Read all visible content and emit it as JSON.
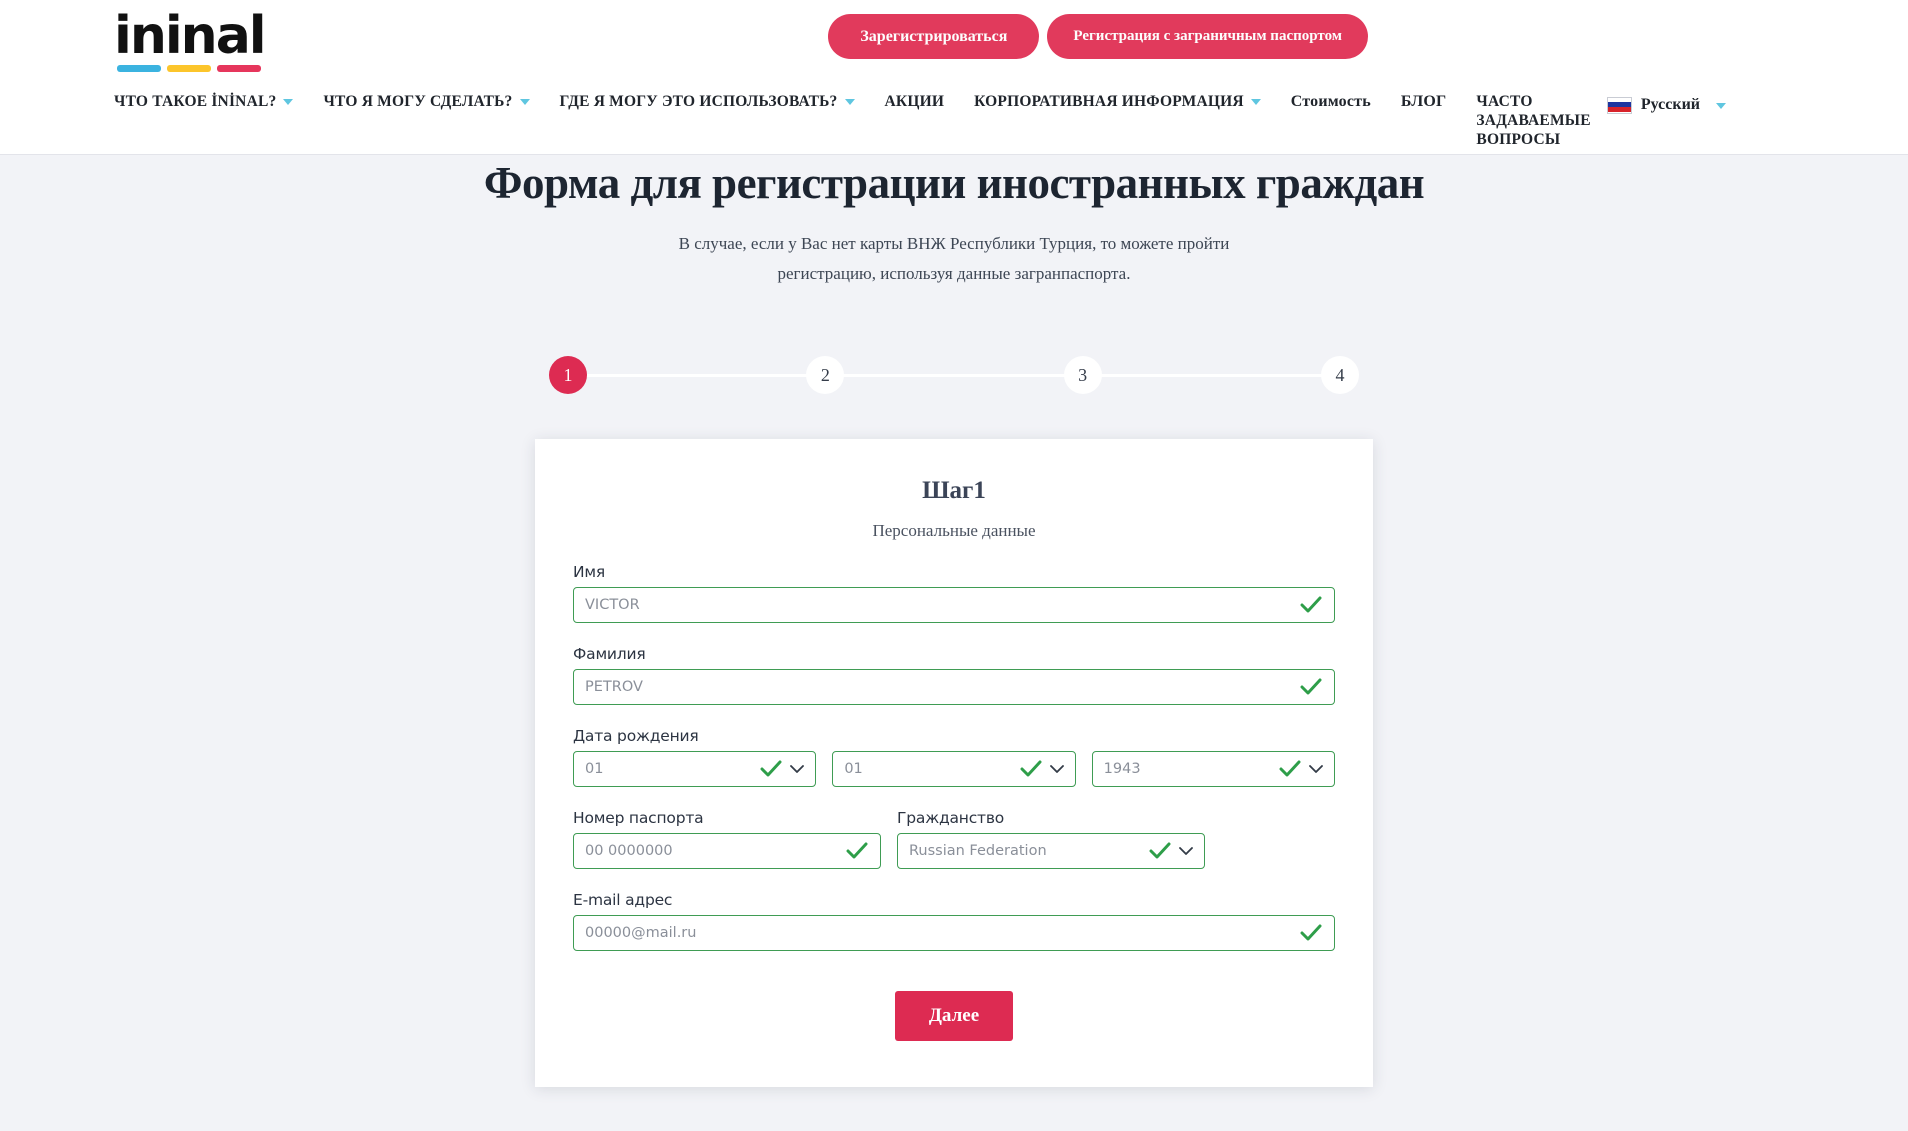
{
  "brand": {
    "logo_text": "ininal",
    "logo_bar_colors": [
      "#3bb3e0",
      "#fcc52b",
      "#e6365c"
    ]
  },
  "header": {
    "register_button": "Зарегистрироваться",
    "passport_register_button": "Регистрация с заграничным паспортом",
    "nav": [
      {
        "label": "ЧТО ТАКОЕ İNİNAL?",
        "has_caret": true
      },
      {
        "label": "ЧТО Я МОГУ СДЕЛАТЬ?",
        "has_caret": true
      },
      {
        "label": "ГДЕ Я МОГУ ЭТО ИСПОЛЬЗОВАТЬ?",
        "has_caret": true
      },
      {
        "label": "АКЦИИ",
        "has_caret": false
      },
      {
        "label": "КОРПОРАТИВНАЯ ИНФОРМАЦИЯ",
        "has_caret": true
      },
      {
        "label": "Стоимость",
        "has_caret": false
      },
      {
        "label": "БЛОГ",
        "has_caret": false
      },
      {
        "label": "ЧАСТО ЗАДАВАЕМЫЕ ВОПРОСЫ",
        "has_caret": false
      }
    ],
    "language": "Русский",
    "flag": "russia-flag-icon"
  },
  "page": {
    "title": "Форма для регистрации иностранных граждан",
    "subtitle": "В случае, если у Вас нет карты ВНЖ Республики Турция, то можете пройти регистрацию, используя данные загранпаспорта."
  },
  "stepper": {
    "steps": [
      "1",
      "2",
      "3",
      "4"
    ],
    "active_index": 0,
    "active_color": "#dd2b52"
  },
  "form": {
    "title": "Шаг1",
    "subtitle": "Персональные данные",
    "valid_color": "#3f9c54",
    "fields": {
      "first_name": {
        "label": "Имя",
        "value": "VICTOR",
        "valid": true
      },
      "last_name": {
        "label": "Фамилия",
        "value": "PETROV",
        "valid": true
      },
      "birth_date": {
        "label": "Дата рождения",
        "day": "01",
        "month": "01",
        "year": "1943",
        "valid": true
      },
      "passport_number": {
        "label": "Номер паспорта",
        "value": "00 0000000",
        "valid": true
      },
      "citizenship": {
        "label": "Гражданство",
        "value": "Russian Federation",
        "valid": true
      },
      "email": {
        "label": "E-mail адрес",
        "value": "00000@mail.ru",
        "valid": true
      }
    },
    "submit_label": "Далее"
  }
}
